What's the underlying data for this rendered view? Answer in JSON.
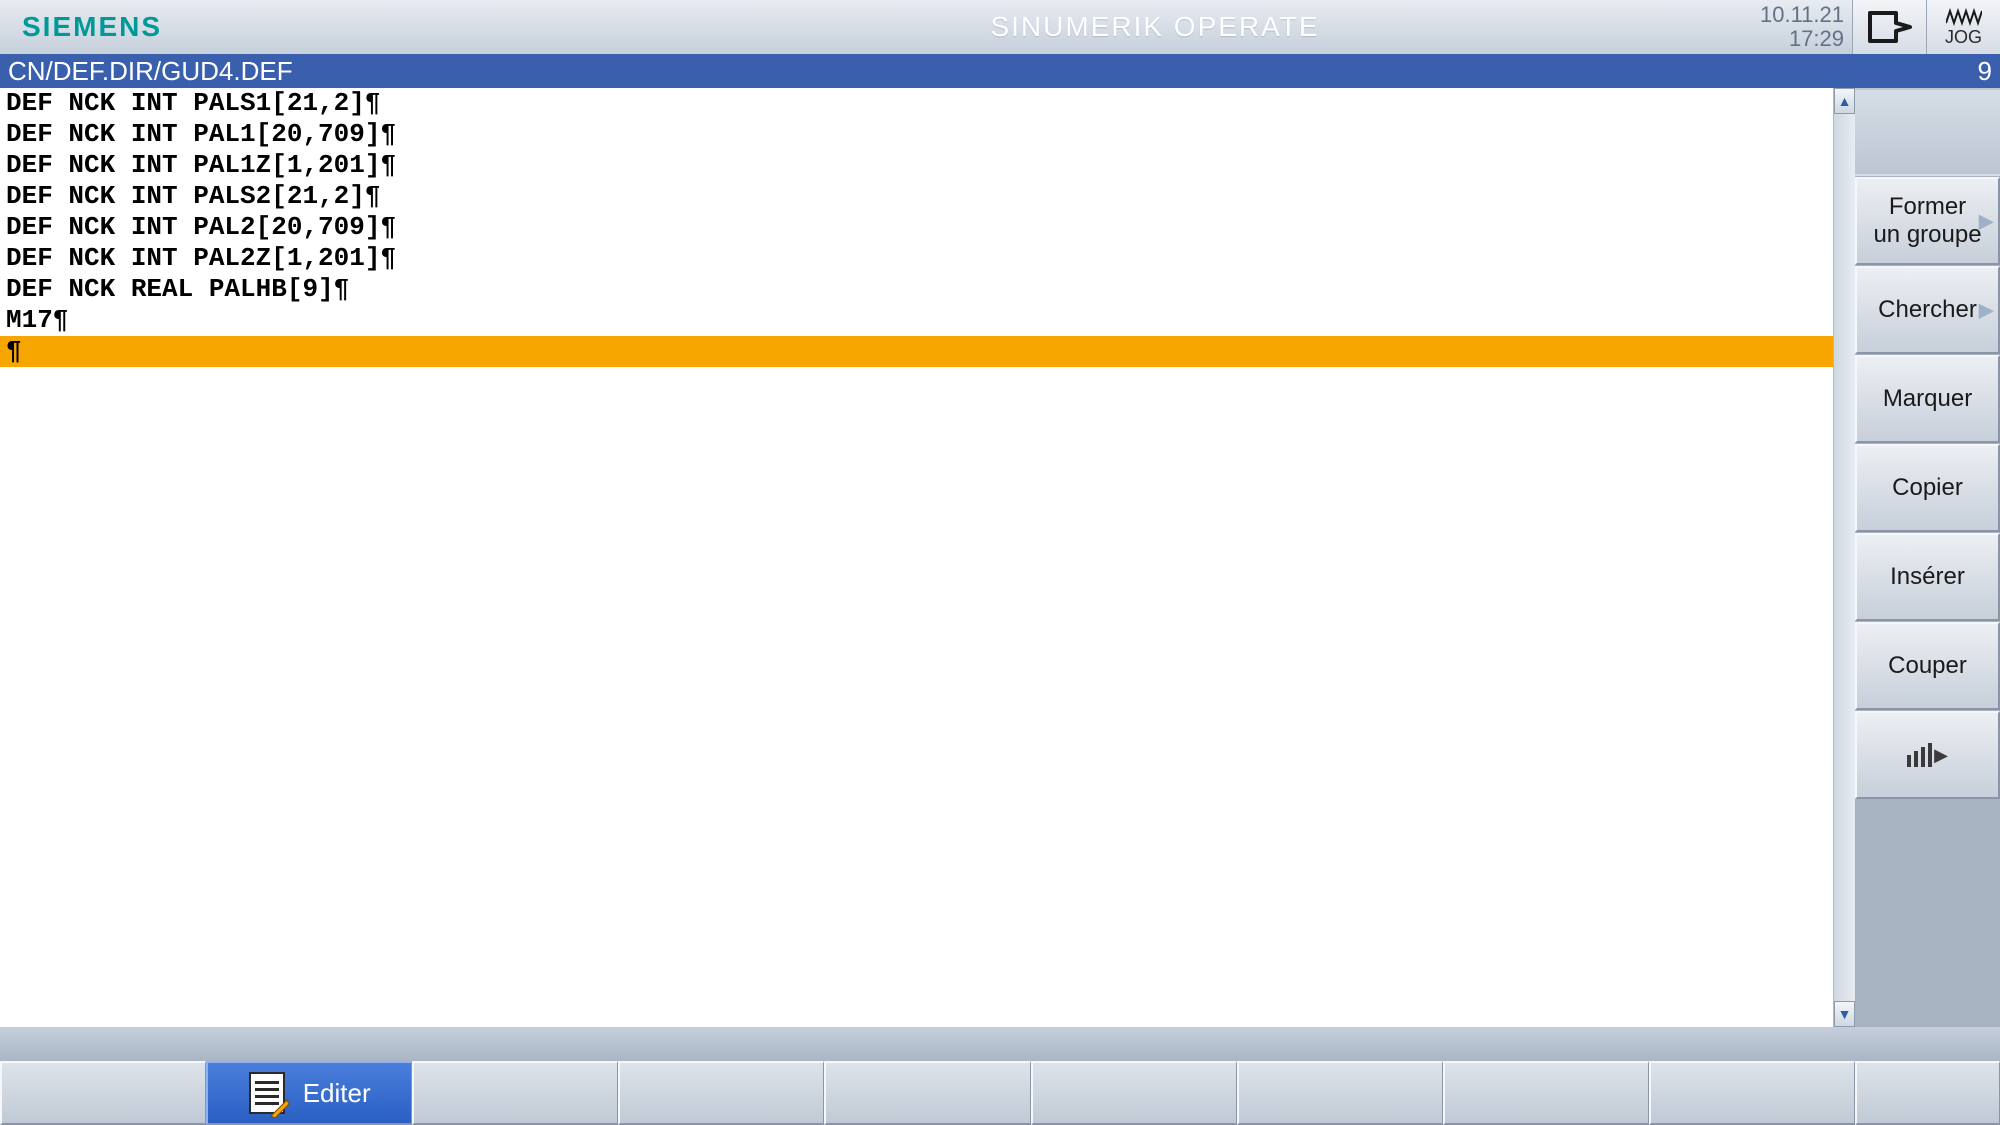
{
  "header": {
    "brand": "SIEMENS",
    "title": "SINUMERIK OPERATE",
    "date": "10.11.21",
    "time": "17:29",
    "mode": "JOG"
  },
  "filebar": {
    "path": "CN/DEF.DIR/GUD4.DEF",
    "line_number": "9"
  },
  "editor": {
    "lines": [
      "DEF NCK INT PALS1[21,2]¶",
      "DEF NCK INT PAL1[20,709]¶",
      "DEF NCK INT PAL1Z[1,201]¶",
      "DEF NCK INT PALS2[21,2]¶",
      "DEF NCK INT PAL2[20,709]¶",
      "DEF NCK INT PAL2Z[1,201]¶",
      "DEF NCK REAL PALHB[9]¶",
      "M17¶"
    ],
    "cursor_line": "¶"
  },
  "sidekeys": {
    "k1": "",
    "k2": "Former\nun groupe",
    "k3": "Chercher",
    "k4": "Marquer",
    "k5": "Copier",
    "k6": "Insérer",
    "k7": "Couper",
    "k8": ""
  },
  "bottomkeys": {
    "k2": "Editer"
  }
}
